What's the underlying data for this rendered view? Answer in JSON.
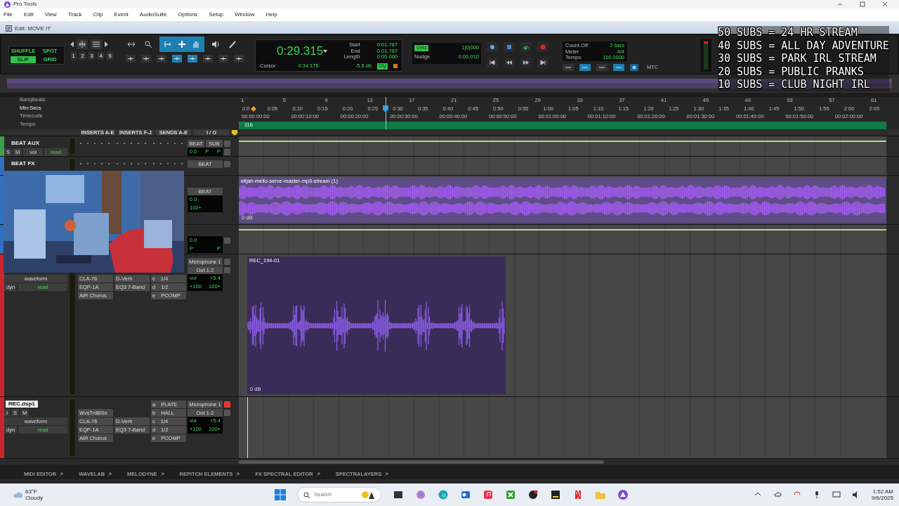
{
  "app": {
    "title": "Pro Tools"
  },
  "menu": [
    "File",
    "Edit",
    "View",
    "Track",
    "Clip",
    "Event",
    "AudioSuite",
    "Options",
    "Setup",
    "Window",
    "Help"
  ],
  "edit_window": {
    "title": "Edit: MOVE IT"
  },
  "edit_modes": [
    {
      "label": "SHUFFLE",
      "selected": false
    },
    {
      "label": "SPOT",
      "selected": false
    },
    {
      "label": "SLIP",
      "selected": true
    },
    {
      "label": "GRID",
      "selected": false
    }
  ],
  "zoom_presets": [
    "1",
    "2",
    "3",
    "4",
    "5"
  ],
  "counter": {
    "main": "0:29.315",
    "fields": [
      {
        "label": "Start",
        "value": "0:01.787"
      },
      {
        "label": "End",
        "value": "0:01.787"
      },
      {
        "label": "Length",
        "value": "0:00.000"
      }
    ],
    "cursor_label": "Cursor",
    "cursor": "0:34.175",
    "level_reading": "-5.6 db",
    "delay": "Dly"
  },
  "grid": {
    "label": "Grid",
    "value": "1|0|000",
    "nudge_label": "Nudge",
    "nudge": "0:00.010"
  },
  "midi": [
    {
      "label": "Count Off",
      "value": "2 bars"
    },
    {
      "label": "Meter",
      "value": "4/4"
    },
    {
      "label": "Tempo",
      "value": "116.0000"
    }
  ],
  "sync_label": "MTC",
  "stream_overlay": [
    "50 SUBS = 24 HR STREAM",
    "40 SUBS = ALL DAY ADVENTURE",
    "30 SUBS = PARK IRL STREAM",
    "20 SUBS = PUBLIC PRANKS",
    "10 SUBS = CLUB NIGHT IRL"
  ],
  "rulers": [
    {
      "kind": "bars",
      "label": "Bars|Beats",
      "ticks": [
        "1",
        "5",
        "9",
        "13",
        "17",
        "21",
        "25",
        "29",
        "33",
        "37",
        "41",
        "45",
        "49",
        "53",
        "57",
        "61"
      ]
    },
    {
      "kind": "minsecs",
      "label": "Min:Secs",
      "ticks": [
        "0:0",
        "0:05",
        "0:10",
        "0:15",
        "0:20",
        "0:25",
        "0:30",
        "0:35",
        "0:40",
        "0:45",
        "0:50",
        "0:55",
        "1:00",
        "1:05",
        "1:10",
        "1:15",
        "1:20",
        "1:25",
        "1:30",
        "1:35",
        "1:40",
        "1:45",
        "1:50",
        "1:55",
        "2:00",
        "2:05"
      ]
    },
    {
      "kind": "timecode",
      "label": "Timecode",
      "ticks": [
        "00:00:00:00",
        "00:00:10:00",
        "00:00:20:00",
        "00:00:30:00",
        "00:00:40:00",
        "00:00:50:00",
        "00:01:00:00",
        "00:01:10:00",
        "00:01:20:00",
        "00:01:30:00",
        "00:01:40:00",
        "00:01:50:00",
        "00:02:00:00"
      ]
    },
    {
      "kind": "tempo",
      "label": "Tempo",
      "ticks": [
        "116"
      ]
    }
  ],
  "columns": [
    "INSERTS A-E",
    "INSERTS F-J",
    "SENDS A-E",
    "I / O"
  ],
  "tracks": [
    {
      "color": "#3aa34a",
      "inserts_collapsed": true,
      "line": true,
      "cursor": false,
      "rows": [
        {
          "controls": [
            {
              "kind": "name",
              "label": "BEAT AUX",
              "selected": false
            }
          ],
          "io": [
            "BEAT",
            "SUB"
          ],
          "io_button": {
            "rec": false
          }
        },
        {
          "controls": [
            {
              "kind": "btn",
              "label": "S"
            },
            {
              "kind": "btn",
              "label": "M"
            },
            {
              "kind": "drop",
              "label": "vol"
            },
            {
              "kind": "auto",
              "label": "read"
            }
          ],
          "vol": [
            "0.0",
            "P",
            "P"
          ],
          "io_button": {
            "rec": false
          }
        }
      ]
    },
    {
      "color": "#2f6fc0",
      "inserts_collapsed": true,
      "line": false,
      "cursor": false,
      "rows": [
        {
          "controls": [
            {
              "kind": "name",
              "label": "BEAT FX",
              "selected": false
            }
          ],
          "io": [
            "BEAT"
          ],
          "io_button": {
            "rec": false
          }
        }
      ]
    },
    {
      "color": "#2f6fc0",
      "inserts_collapsed": false,
      "line": false,
      "cursor": false,
      "rows": [
        {
          "io": [
            "BEAT"
          ]
        },
        {
          "vol": [
            "0.0"
          ]
        },
        {
          "vol": [
            "100+"
          ]
        }
      ],
      "clip": {
        "kind": "stereo",
        "name": "elijah-mello-serve-master-mp3-stream (1)",
        "gain": "0 dB"
      }
    },
    {
      "color": "#2f6fc0",
      "inserts_collapsed": false,
      "line": true,
      "cursor": false,
      "rows": [
        {
          "vol": [
            "0.0"
          ],
          "io_button": {
            "rec": false
          }
        },
        {
          "vol": [
            "P",
            "P"
          ]
        }
      ]
    },
    {
      "color": "#c8262b",
      "inserts_collapsed": false,
      "line": false,
      "cursor": false,
      "rows": [
        {
          "io": [
            "Microphone 1"
          ],
          "io_button": {
            "rec": false
          }
        },
        {
          "io": [
            "Out 1-2"
          ],
          "io_button": {
            "rec": false
          }
        },
        {
          "controls": [
            {
              "kind": "drop",
              "label": "waveform"
            }
          ],
          "insert_ae": "CLA-76",
          "insert_fj": "D-Verb",
          "send": {
            "letter": "c",
            "name": "1/4"
          },
          "vol": [
            "vol",
            "+5.4"
          ]
        },
        {
          "controls": [
            {
              "kind": "btn",
              "label": "dyn"
            },
            {
              "kind": "auto",
              "label": "read"
            }
          ],
          "insert_ae": "EQP-1A",
          "insert_fj": "EQ3 7-Band",
          "send": {
            "letter": "d",
            "name": "1/2"
          },
          "vol": [
            "+100",
            "100+"
          ]
        },
        {
          "insert_ae": "AIR Chorus",
          "send": {
            "letter": "e",
            "name": "PCOMP"
          }
        }
      ],
      "clip": {
        "kind": "mono",
        "name": "REC_194-01",
        "gain": "0 dB"
      }
    },
    {
      "color": "#c8262b",
      "inserts_collapsed": false,
      "line": false,
      "cursor": true,
      "rows": [
        {
          "controls": [
            {
              "kind": "name",
              "label": "REC.dsp1",
              "selected": true
            }
          ],
          "send": {
            "letter": "a",
            "name": "PLATE"
          },
          "io": [
            "Microphone 1"
          ],
          "io_button": {
            "rec": true
          }
        },
        {
          "controls": [
            {
              "kind": "btn",
              "label": "I"
            },
            {
              "kind": "btn",
              "label": "S"
            },
            {
              "kind": "btn",
              "label": "M"
            }
          ],
          "insert_ae": "WvsTrdBSn",
          "send": {
            "letter": "b",
            "name": "HALL"
          },
          "io": [
            "Out 1-2"
          ],
          "io_button": {
            "rec": false
          }
        },
        {
          "controls": [
            {
              "kind": "drop",
              "label": "waveform"
            }
          ],
          "insert_ae": "CLA-76",
          "insert_fj": "D-Verb",
          "send": {
            "letter": "c",
            "name": "1/4"
          },
          "vol": [
            "vol",
            "+5.4"
          ]
        },
        {
          "controls": [
            {
              "kind": "btn",
              "label": "dyn"
            },
            {
              "kind": "auto",
              "label": "read"
            }
          ],
          "insert_ae": "EQP-1A",
          "insert_fj": "EQ3 7-Band",
          "send": {
            "letter": "d",
            "name": "1/2"
          },
          "vol": [
            "+100",
            "100+"
          ]
        },
        {
          "insert_ae": "AIR Chorus",
          "send": {
            "letter": "e",
            "name": "PCOMP"
          }
        }
      ]
    }
  ],
  "bottom_tabs": [
    "MIDI EDITOR",
    "WAVELAB",
    "MELODYNE",
    "REPITCH ELEMENTS",
    "FX SPECTRAL EDITOR",
    "SPECTRALAYERS"
  ],
  "taskbar": {
    "temperature": "63°F",
    "weather": "Cloudy",
    "search_placeholder": "Search",
    "time": "1:52 AM",
    "date": "9/6/2025"
  }
}
